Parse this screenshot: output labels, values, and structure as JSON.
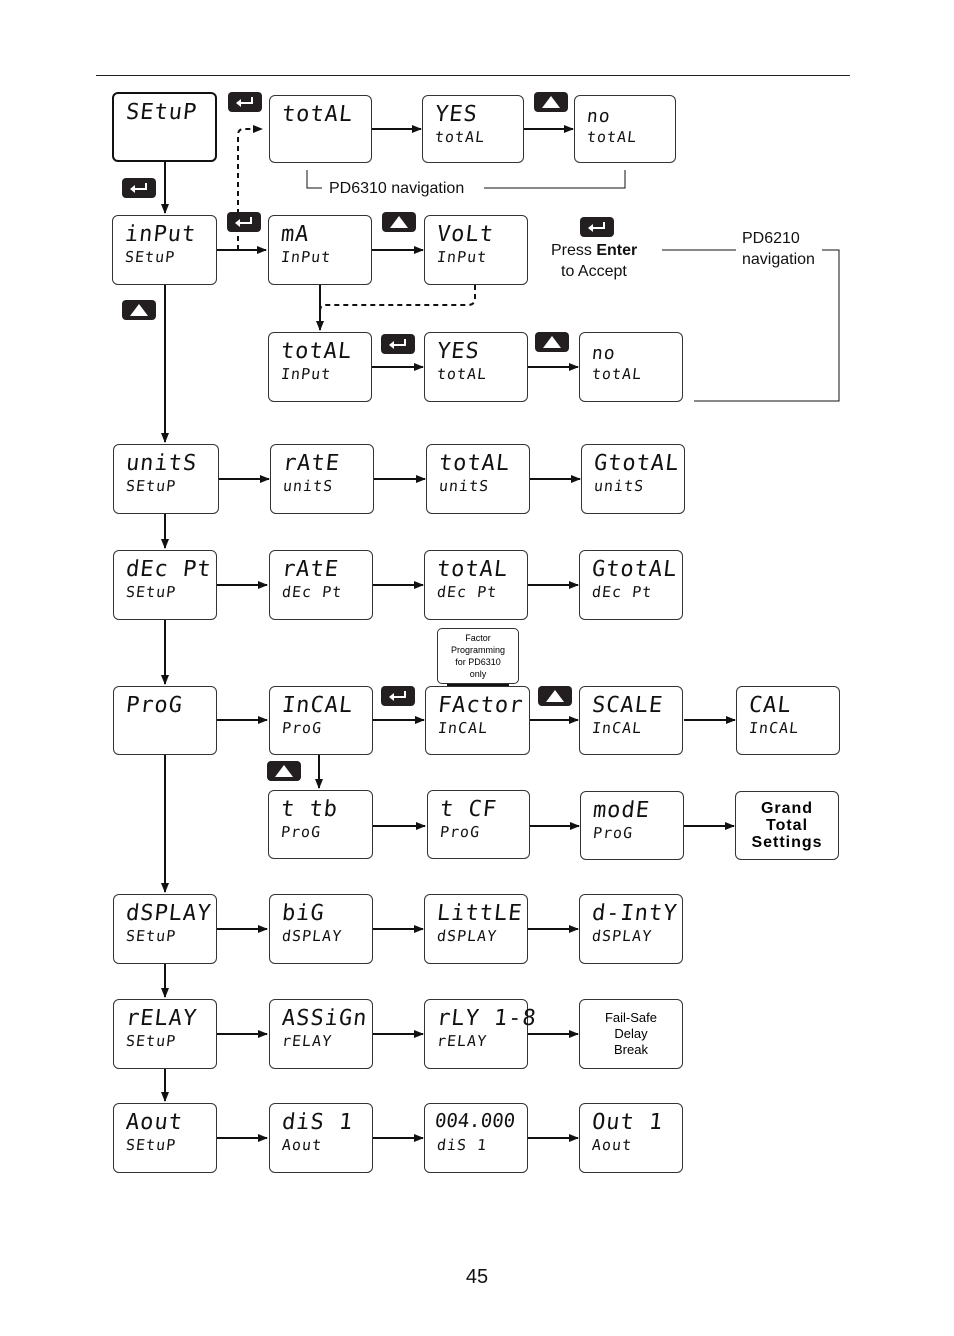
{
  "page_number": "45",
  "annotations": {
    "pd6310_nav": "PD6310 navigation",
    "press_enter_1": "Press ",
    "press_enter_bold": "Enter",
    "press_enter_2": "to Accept",
    "pd6210_nav_1": "PD6210",
    "pd6210_nav_2": "navigation",
    "factor_note": [
      "Factor",
      "Programming",
      "for PD6310",
      "only"
    ]
  },
  "keys": {
    "enter": "enter-key",
    "up": "up-arrow-key"
  },
  "rows": {
    "setup": {
      "main": "SEtuP",
      "sub": ""
    },
    "total_top": {
      "main": "totAL",
      "sub": ""
    },
    "yes_top": {
      "main": "YES",
      "sub": "totAL"
    },
    "no_top": {
      "main": "no",
      "sub": "totAL"
    },
    "input": {
      "main": "inPut",
      "sub": "SEtuP"
    },
    "ma": {
      "main": "mA",
      "sub": "InPut"
    },
    "volt": {
      "main": "VoLt",
      "sub": "InPut"
    },
    "total_in": {
      "main": "totAL",
      "sub": "InPut"
    },
    "yes_in": {
      "main": "YES",
      "sub": "totAL"
    },
    "no_in": {
      "main": "no",
      "sub": "totAL"
    },
    "units": {
      "main": "unitS",
      "sub": "SEtuP"
    },
    "rate_u": {
      "main": "rAtE",
      "sub": "unitS"
    },
    "total_u": {
      "main": "totAL",
      "sub": "unitS"
    },
    "gtotal_u": {
      "main": "GtotAL",
      "sub": "unitS"
    },
    "decpt": {
      "main": "dEc Pt",
      "sub": "SEtuP"
    },
    "rate_d": {
      "main": "rAtE",
      "sub": "dEc Pt"
    },
    "total_d": {
      "main": "totAL",
      "sub": "dEc Pt"
    },
    "gtotal_d": {
      "main": "GtotAL",
      "sub": "dEc Pt"
    },
    "prog": {
      "main": "ProG",
      "sub": ""
    },
    "incal": {
      "main": "InCAL",
      "sub": "ProG"
    },
    "factor": {
      "main": "FActor",
      "sub": "InCAL"
    },
    "scale": {
      "main": "SCALE",
      "sub": "InCAL"
    },
    "cal": {
      "main": "CAL",
      "sub": "InCAL"
    },
    "ttb": {
      "main": "t tb",
      "sub": "ProG"
    },
    "tcf": {
      "main": "t CF",
      "sub": "ProG"
    },
    "mode": {
      "main": "modE",
      "sub": "ProG"
    },
    "grand": {
      "lines": [
        "Grand",
        "Total",
        "Settings"
      ]
    },
    "display": {
      "main": "dSPLAY",
      "sub": "SEtuP"
    },
    "big": {
      "main": "biG",
      "sub": "dSPLAY"
    },
    "little": {
      "main": "LittLE",
      "sub": "dSPLAY"
    },
    "dinty": {
      "main": "d-IntY",
      "sub": "dSPLAY"
    },
    "relay": {
      "main": "rELAY",
      "sub": "SEtuP"
    },
    "assign": {
      "main": "ASSiGn",
      "sub": "rELAY"
    },
    "rly": {
      "main": "rLY 1-8",
      "sub": "rELAY"
    },
    "failsafe": {
      "lines": [
        "Fail-Safe",
        "Delay",
        "Break"
      ]
    },
    "aout": {
      "main": "Aout",
      "sub": "SEtuP"
    },
    "dis1": {
      "main": "diS 1",
      "sub": "Aout"
    },
    "val": {
      "main": "004.000",
      "sub": "diS 1"
    },
    "out1": {
      "main": "Out 1",
      "sub": "Aout"
    }
  }
}
